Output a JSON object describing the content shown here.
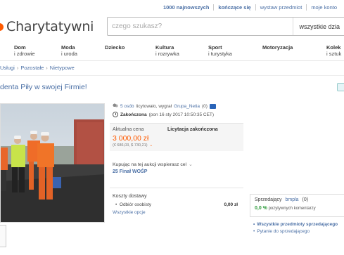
{
  "toplinks": [
    "1000 najnowszych",
    "kończące się",
    "wystaw przedmiot",
    "moje konto"
  ],
  "logo": {
    "text": "Charytatywni",
    "color": "#ff5a00"
  },
  "search": {
    "placeholder": "czego szukasz?",
    "category": "wszystkie dzia"
  },
  "nav": [
    {
      "l1": "Dom",
      "l2": "i zdrowie"
    },
    {
      "l1": "Moda",
      "l2": "i uroda"
    },
    {
      "l1": "Dziecko",
      "l2": ""
    },
    {
      "l1": "Kultura",
      "l2": "i rozrywka"
    },
    {
      "l1": "Sport",
      "l2": "i turystyka"
    },
    {
      "l1": "Motoryzacja",
      "l2": ""
    },
    {
      "l1": "Kolek",
      "l2": "i sztuk"
    }
  ],
  "breadcrumb": [
    "Usługi",
    "Pozostałe",
    "Nietypowe"
  ],
  "title": "denta Piły w swojej Firmie!",
  "meta": {
    "views": "5 osób",
    "views_rest": "licytowało, wygrał",
    "winner": "Grupa_Netia",
    "winner_score": "(0)",
    "status_label": "Zakończona",
    "ended": "(pon 16 sty 2017 10:50:35 CET)"
  },
  "price": {
    "label": "Aktualna cena",
    "status": "Licytacja zakończona",
    "value": "3 000,00 zł",
    "conversion": "(€ 686,03, $ 730,21)"
  },
  "charity": {
    "label": "Kupując na tej aukcji wspierasz cel",
    "name": "25 Finał WOŚP"
  },
  "shipping": {
    "title": "Koszty dostawy",
    "method": "Odbiór osobisty",
    "cost": "0,00 zł",
    "link": "Wszystkie opcje"
  },
  "seller": {
    "label": "Sprzedający",
    "name": "bmpla",
    "score": "(0)",
    "percent": "0,0 %",
    "percent_text": "pozytywnych komentarzy",
    "links": [
      "Wszystkie przedmioty sprzedającego",
      "Pytanie do sprzedającego"
    ]
  },
  "colors": {
    "accent": "#ff5a00",
    "link": "#4a6fa5",
    "positive": "#2c9a3a"
  }
}
